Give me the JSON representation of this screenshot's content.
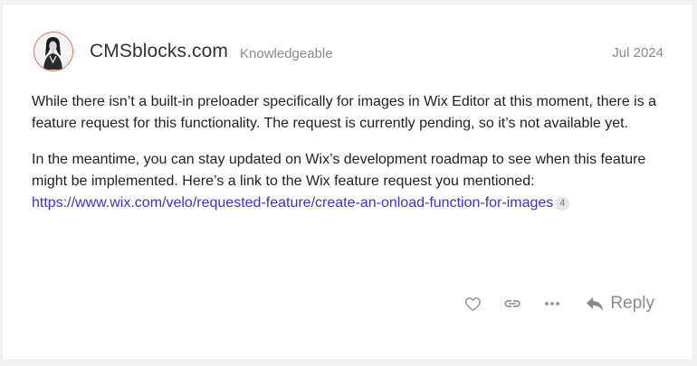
{
  "post": {
    "username": "CMSblocks.com",
    "user_title": "Knowledgeable",
    "date": "Jul 2024",
    "paragraph1": "While there isn’t a built-in preloader specifically for images in Wix Editor at this moment, there is a feature request for this functionality. The request is currently pending, so it’s not available yet.",
    "paragraph2": "In the meantime, you can stay updated on Wix’s development roadmap to see when this feature might be implemented. Here’s a link to the Wix feature request you mentioned:",
    "link_text": "https://www.wix.com/velo/requested-feature/create-an-onload-function-for-images",
    "link_clicks": "4"
  },
  "actions": {
    "reply_label": "Reply",
    "icons": [
      "heart-icon",
      "link-icon",
      "more-icon",
      "reply-icon"
    ]
  },
  "colors": {
    "link": "#3d33c6",
    "muted": "#8a8a8a",
    "avatar_border": "#e06a4e"
  }
}
